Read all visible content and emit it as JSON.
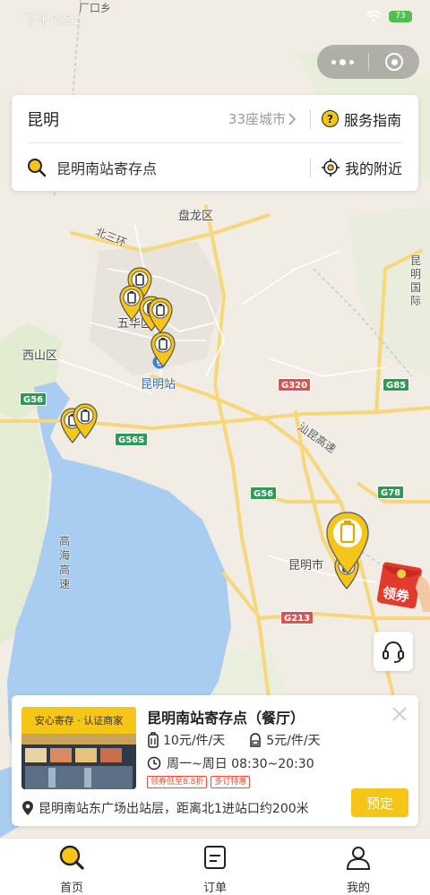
{
  "status_bar": {
    "time": "下午4:51",
    "battery": "73"
  },
  "search_card": {
    "city": "昆明",
    "city_count": "33座城市",
    "service_guide": "服务指南",
    "search_value": "昆明南站寄存点",
    "nearby": "我的附近"
  },
  "map": {
    "labels": {
      "guangkou": "厂口乡",
      "panlong": "盘龙区",
      "beisanhuan": "北三环",
      "wuhua": "五华区",
      "xishan": "西山区",
      "kunming_station": "昆明站",
      "kunming_city": "昆明市",
      "kunming_intl": "昆明国际",
      "shikun": "汕昆高速",
      "gaohai": "高海高速"
    },
    "shields": {
      "g320": "G320",
      "g85": "G85",
      "g56": "G56",
      "g56s": "G56S",
      "g56b": "G56",
      "g78": "G78",
      "g213": "G213"
    },
    "coupon_label": "领券"
  },
  "store_card": {
    "thumb_tag": "安心寄存 · 认证商家",
    "name": "昆明南站寄存点（餐厅）",
    "price_large": "10元/件/天",
    "price_small": "5元/件/天",
    "hours": "周一~周日 08:30~20:30",
    "badges": [
      "领券低至8.8折",
      "多订特惠"
    ],
    "address": "昆明南站东广场出站层，距离北1进站口约200米",
    "reserve_label": "预定"
  },
  "tabs": [
    {
      "label": "首页"
    },
    {
      "label": "订单"
    },
    {
      "label": "我的"
    }
  ],
  "colors": {
    "accent": "#f5c518",
    "water": "#a9cdf0",
    "map_bg": "#f1ede4"
  }
}
